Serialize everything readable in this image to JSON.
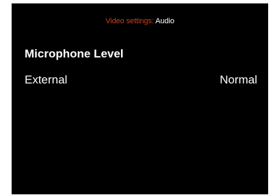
{
  "header": {
    "parent": "Video settings:",
    "current": "Audio"
  },
  "section": {
    "title": "Microphone Level"
  },
  "settings": [
    {
      "label": "External",
      "value": "Normal"
    }
  ],
  "colors": {
    "background": "#000000",
    "accent": "#c7401c",
    "text": "#ffffff"
  }
}
